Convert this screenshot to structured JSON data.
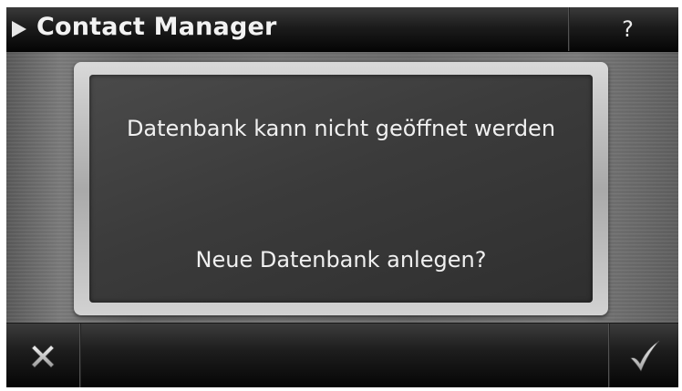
{
  "header": {
    "title": "Contact Manager",
    "help_label": "?"
  },
  "dialog": {
    "message": "Datenbank kann nicht geöffnet werden",
    "question": "Neue Datenbank anlegen?"
  },
  "footer": {
    "cancel_icon": "close-icon",
    "confirm_icon": "checkmark-icon"
  },
  "colors": {
    "bar_background": "#0a0a0a",
    "dialog_background": "#3b3b3b",
    "frame": "#c4c4c4",
    "text": "#f0f0f0"
  }
}
